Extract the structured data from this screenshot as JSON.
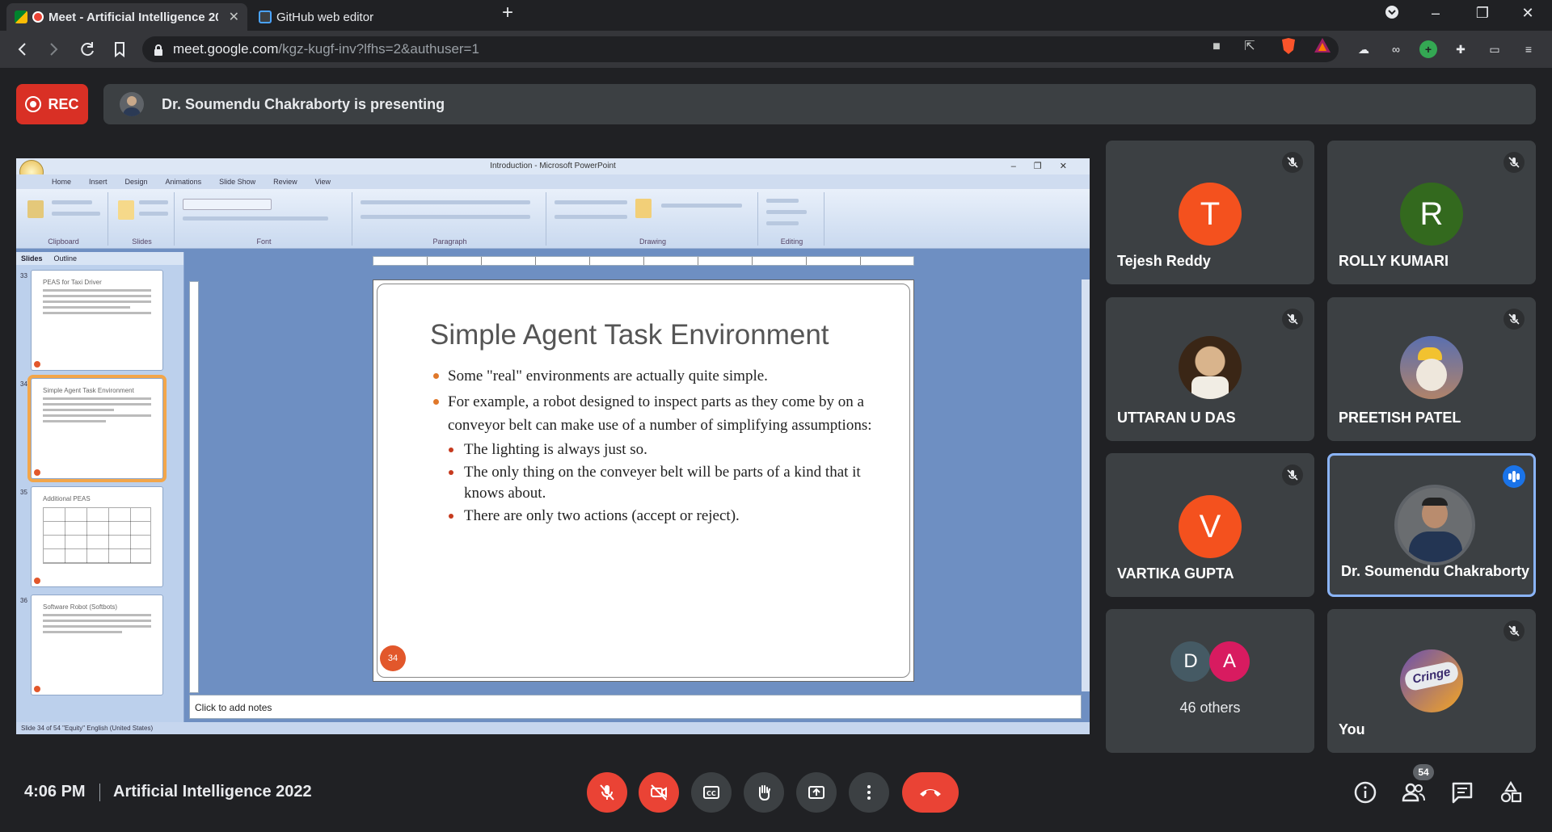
{
  "browser": {
    "tabs": [
      {
        "title": "Meet - Artificial Intelligence 20",
        "active": true,
        "favicon": "google-meet-icon"
      },
      {
        "title": "GitHub web editor",
        "active": false,
        "favicon": "vscode-icon"
      }
    ],
    "url_host": "meet.google.com",
    "url_path": "/kgz-kugf-inv?lfhs=2&authuser=1"
  },
  "meet": {
    "rec_label": "REC",
    "presenting_text": "Dr. Soumendu Chakraborty is presenting",
    "clock": "4:06 PM",
    "meeting_title": "Artificial Intelligence 2022",
    "participant_count": "54"
  },
  "presentation": {
    "window_title": "Introduction - Microsoft PowerPoint",
    "ribbon_tabs": [
      "Home",
      "Insert",
      "Design",
      "Animations",
      "Slide Show",
      "Review",
      "View"
    ],
    "ribbon_groups": [
      "Clipboard",
      "Slides",
      "Font",
      "Paragraph",
      "Drawing",
      "Editing"
    ],
    "pane_tabs": [
      "Slides",
      "Outline"
    ],
    "thumbnails": [
      {
        "num": "33",
        "title": "PEAS for Taxi Driver"
      },
      {
        "num": "34",
        "title": "Simple Agent Task Environment"
      },
      {
        "num": "35",
        "title": "Additional PEAS"
      },
      {
        "num": "36",
        "title": "Software Robot (Softbots)"
      }
    ],
    "slide": {
      "title": "Simple Agent Task Environment",
      "bullets": [
        "Some \"real\" environments are actually quite simple.",
        "For example, a robot designed to inspect parts as they come by on a conveyor belt can make use of a number of simplifying assumptions:"
      ],
      "sub_bullets": [
        "The lighting is always just so.",
        "The only thing on the conveyer belt will be parts of a kind that it knows about.",
        "There are only two actions (accept or reject)."
      ],
      "number": "34"
    },
    "notes_placeholder": "Click to add notes",
    "status_text": "Slide 34 of 54    \"Equity\"    English (United States)"
  },
  "participants": [
    {
      "name": "Tejesh Reddy",
      "initial": "T",
      "avatar_color": "#f4511e",
      "muted": true
    },
    {
      "name": "ROLLY KUMARI",
      "initial": "R",
      "avatar_color": "#33691e",
      "muted": true
    },
    {
      "name": "UTTARAN U DAS",
      "avatar": "portrait-photo",
      "muted": true
    },
    {
      "name": "PREETISH PATEL",
      "avatar": "dog-photo",
      "muted": true
    },
    {
      "name": "VARTIKA GUPTA",
      "initial": "V",
      "avatar_color": "#f4511e",
      "muted": true
    },
    {
      "name": "Dr. Soumendu Chakraborty",
      "avatar": "presenter-photo",
      "muted": false,
      "speaking": true
    },
    {
      "others_label": "46 others",
      "initials": [
        "D",
        "A"
      ],
      "colors": [
        "#455a64",
        "#d81b60"
      ]
    },
    {
      "name": "You",
      "avatar": "cringe-sticker",
      "avatar_text": "Cringe",
      "muted": true
    }
  ]
}
